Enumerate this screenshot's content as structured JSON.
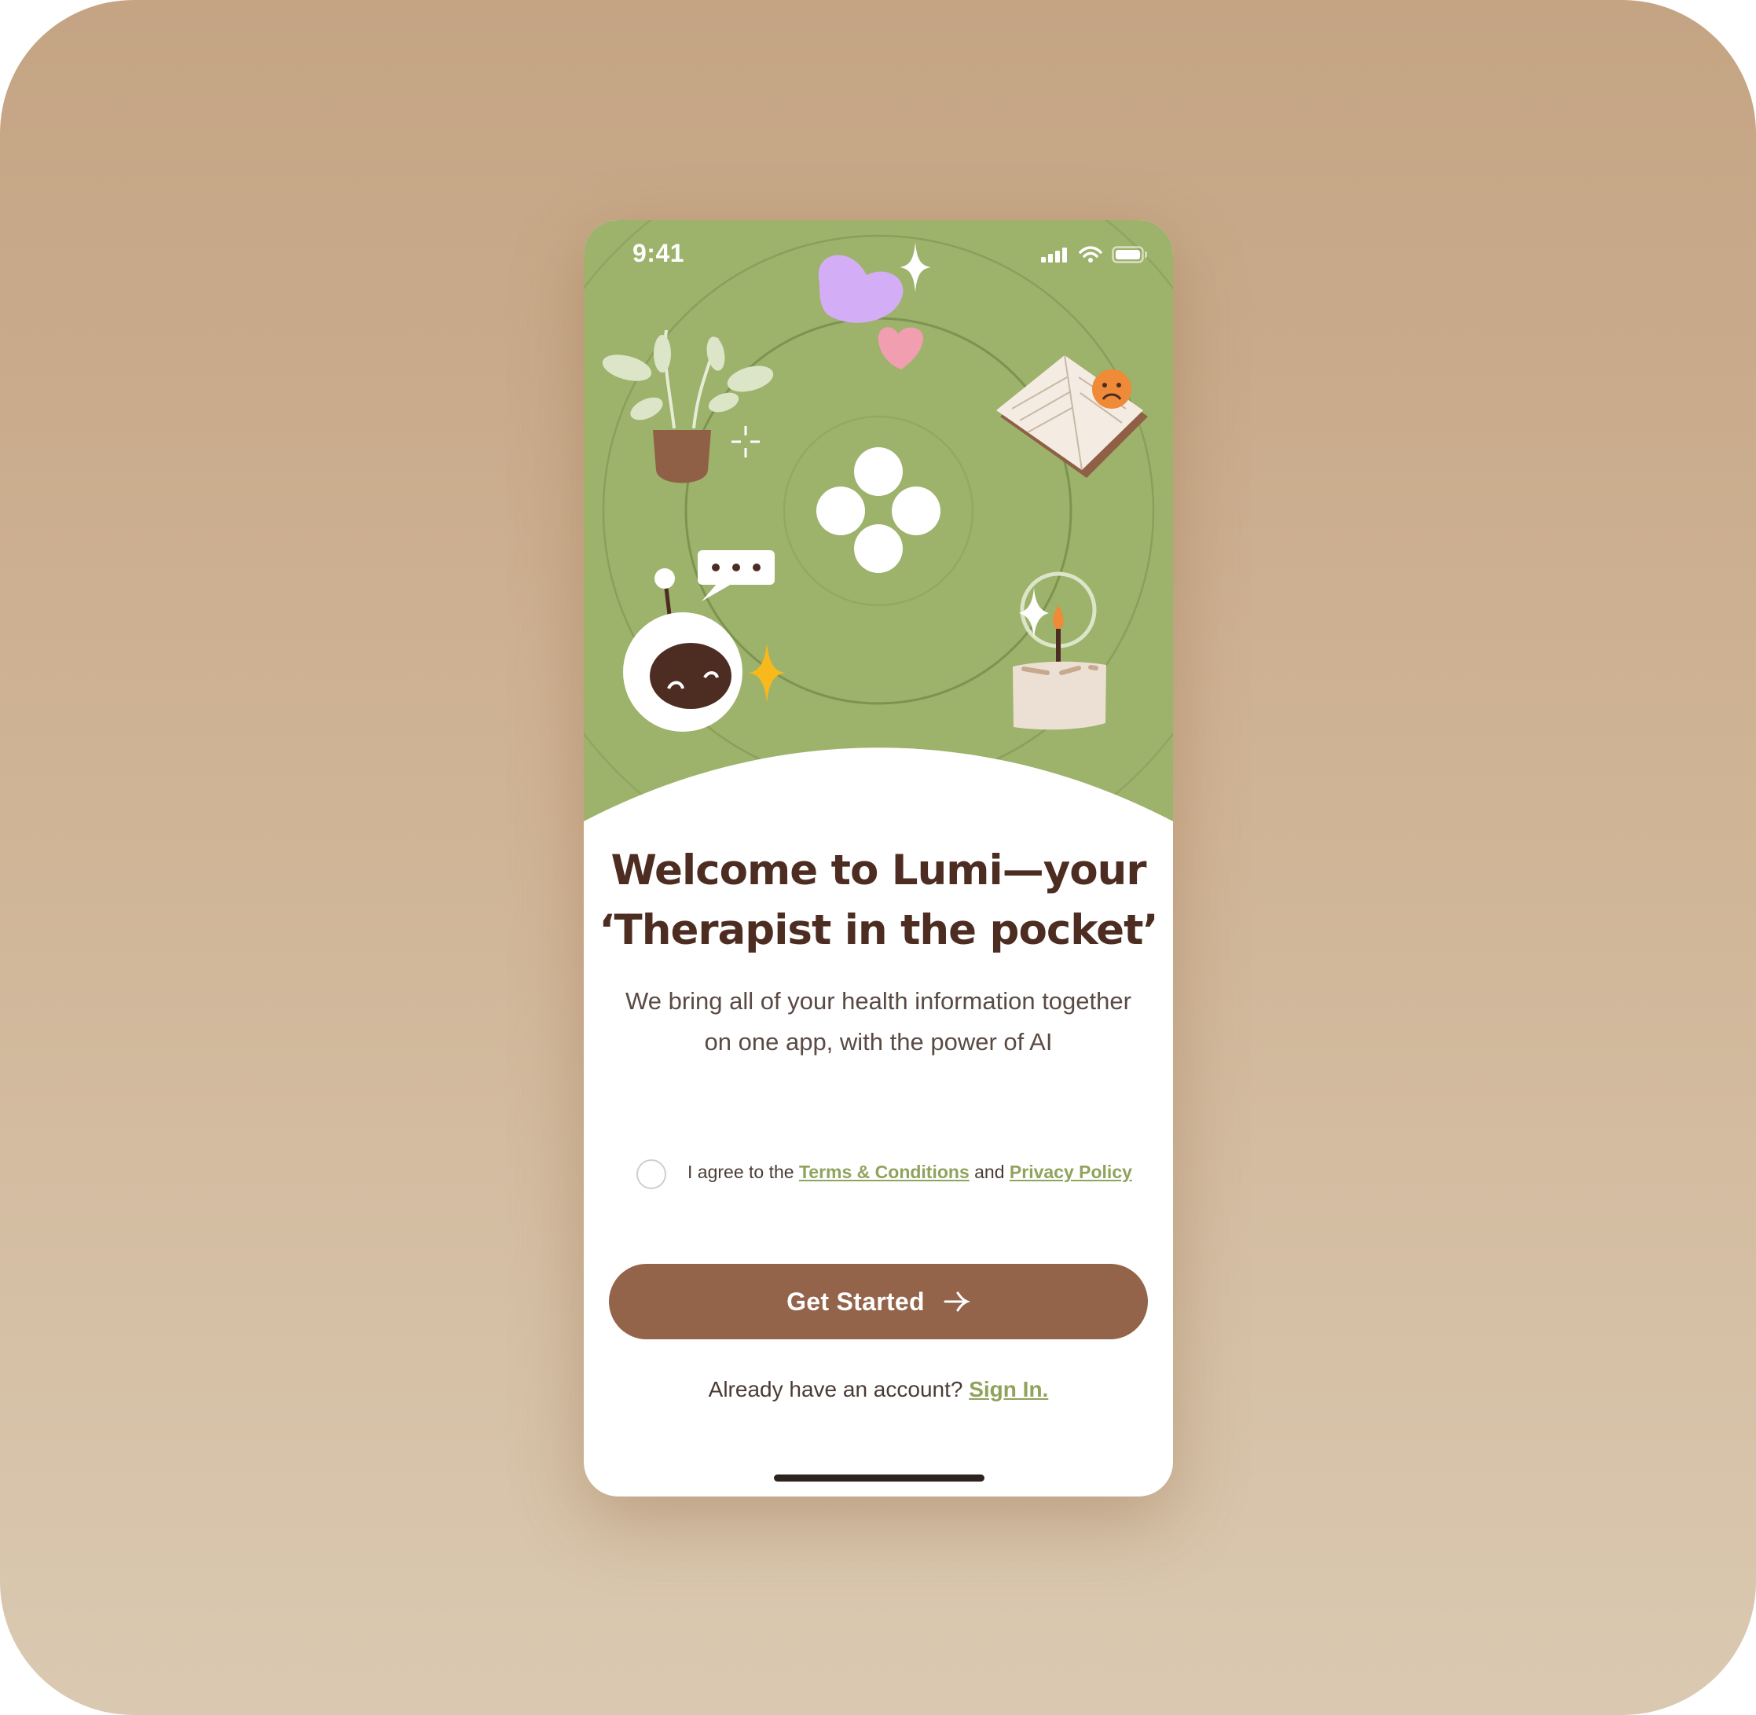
{
  "status_bar": {
    "time": "9:41"
  },
  "onboarding": {
    "title_line1": "Welcome to Lumi—your",
    "title_line2": "‘Therapist in the pocket’",
    "subtitle_line1": "We bring all of your health information together",
    "subtitle_line2": "on one app, with the power of AI",
    "agree_prefix": "I agree to the",
    "terms_link": "Terms & Conditions",
    "agree_middle": "and",
    "privacy_link": "Privacy Policy",
    "cta_label": "Get Started",
    "signin_prompt": "Already have an account?",
    "signin_link": "Sign In."
  },
  "colors": {
    "hero_green": "#9db26b",
    "primary_brown": "#93634a",
    "link_green": "#8fa35c",
    "title_brown": "#4d2d22"
  },
  "icons": [
    "signal-icon",
    "wifi-icon",
    "battery-icon",
    "arrow-right-icon"
  ]
}
